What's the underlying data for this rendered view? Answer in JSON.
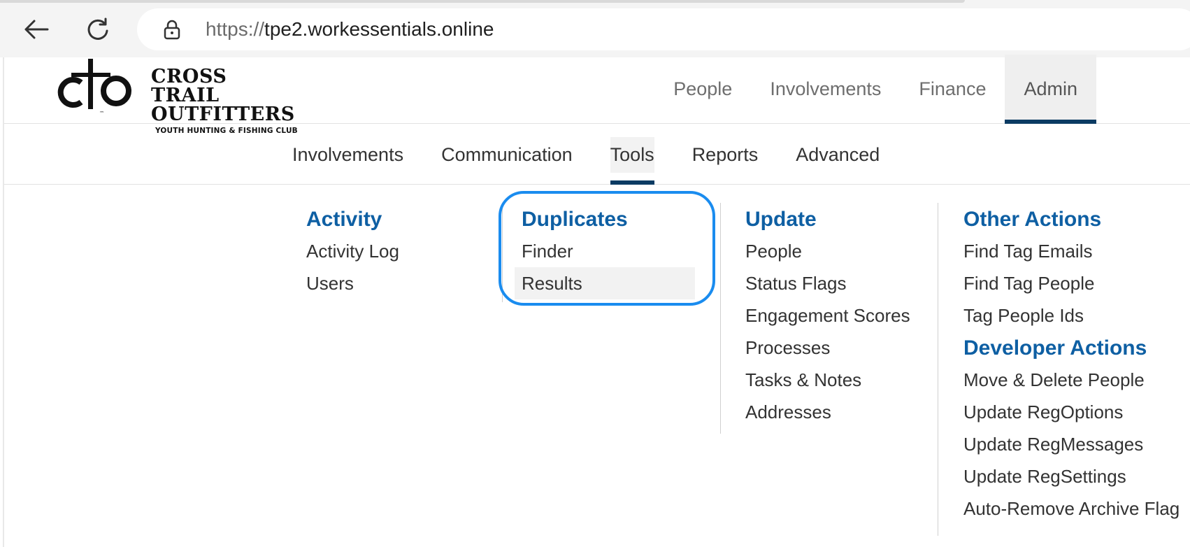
{
  "browser": {
    "url_scheme": "https://",
    "url_host": "tpe2.workessentials.online"
  },
  "logo": {
    "line1": "CROSS TRAIL",
    "line2": "OUTFITTERS",
    "line3": "YOUTH HUNTING & FISHING CLUB",
    "tm": "™"
  },
  "top_nav": [
    "People",
    "Involvements",
    "Finance",
    "Admin"
  ],
  "top_nav_active": "Admin",
  "sub_nav": [
    "Involvements",
    "Communication",
    "Tools",
    "Reports",
    "Advanced"
  ],
  "sub_nav_active": "Tools",
  "menu": {
    "activity": {
      "heading": "Activity",
      "items": [
        "Activity Log",
        "Users"
      ]
    },
    "duplicates": {
      "heading": "Duplicates",
      "items": [
        "Finder",
        "Results"
      ]
    },
    "update": {
      "heading": "Update",
      "items": [
        "People",
        "Status Flags",
        "Engagement Scores",
        "Processes",
        "Tasks & Notes",
        "Addresses"
      ]
    },
    "other_actions": {
      "heading": "Other Actions",
      "items": [
        "Find Tag Emails",
        "Find Tag People",
        "Tag People Ids"
      ]
    },
    "developer_actions": {
      "heading": "Developer Actions",
      "items": [
        "Move & Delete People",
        "Update RegOptions",
        "Update RegMessages",
        "Update RegSettings",
        "Auto-Remove Archive Flag"
      ]
    }
  },
  "colors": {
    "heading": "#0e5fa3",
    "active_underline": "#0b3b63",
    "highlight_ring": "#1a8cef"
  }
}
